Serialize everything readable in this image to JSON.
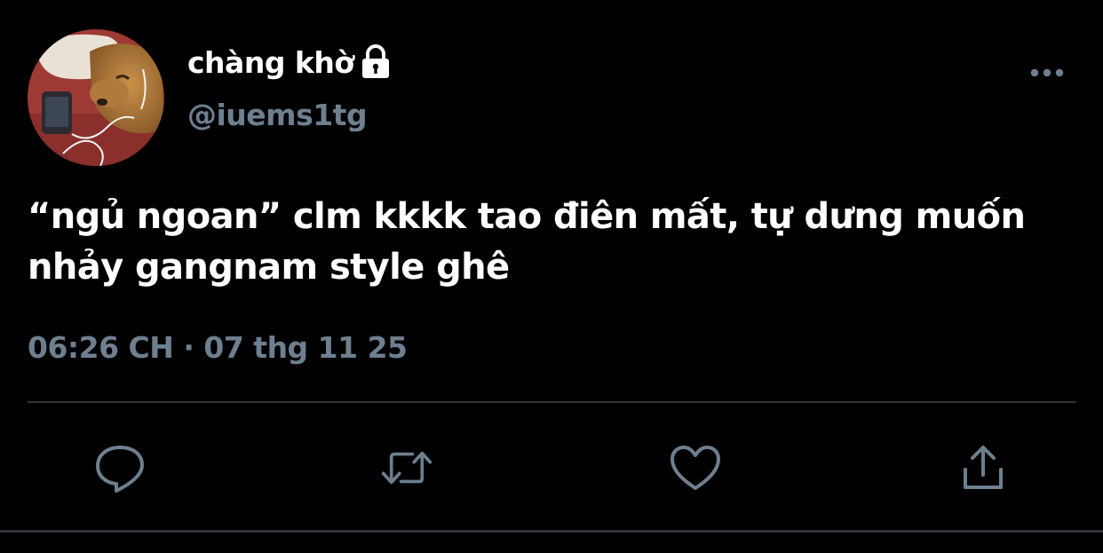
{
  "tweet": {
    "display_name": "chàng khờ",
    "handle": "@iuems1tg",
    "text": "“ngủ ngoan” clm kkkk tao điên mất, tự dưng muốn nhảy gangnam style ghê",
    "timestamp": "06:26 CH · 07 thg 11 25"
  },
  "icons": {
    "avatar": "avatar-photo-dog-with-phone",
    "lock": "lock-icon",
    "more": "more-options-icon",
    "reply": "reply-icon",
    "retweet": "retweet-icon",
    "like": "heart-icon",
    "share": "share-icon"
  },
  "colors": {
    "background": "#000000",
    "primary_text": "#ffffff",
    "secondary_text": "#6e7f8f",
    "divider": "#2f3336"
  }
}
